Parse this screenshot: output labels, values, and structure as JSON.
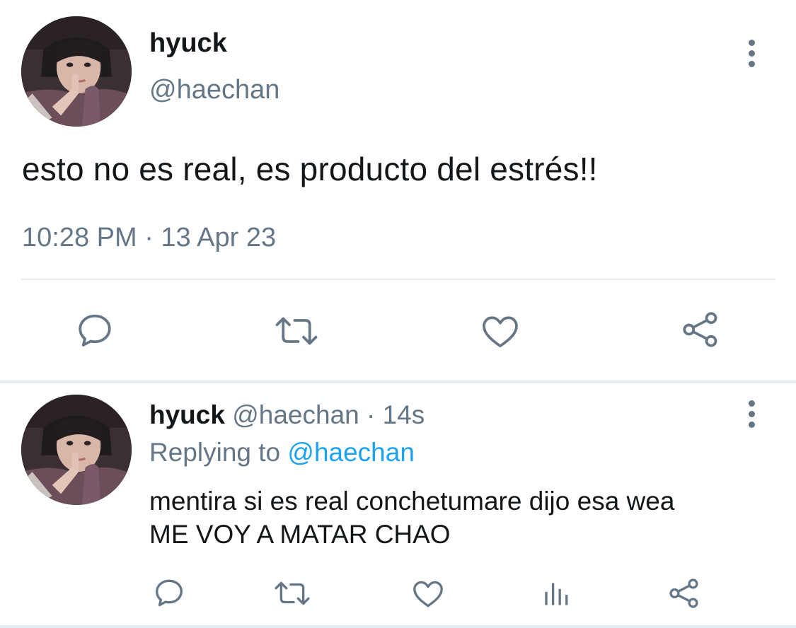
{
  "main_tweet": {
    "display_name": "hyuck",
    "handle": "@haechan",
    "text": "esto no es real, es producto del estrés!!",
    "timestamp": "10:28 PM · 13 Apr 23",
    "actions": [
      "reply-icon",
      "retweet-icon",
      "like-icon",
      "share-icon"
    ]
  },
  "reply_tweet": {
    "display_name": "hyuck",
    "handle": "@haechan",
    "age": "· 14s",
    "replying_prefix": "Replying to ",
    "replying_to": "@haechan",
    "text_line1": "mentira si es real conchetumare dijo esa wea",
    "text_line2": "ME VOY A MATAR CHAO",
    "actions": [
      "reply-icon",
      "retweet-icon",
      "like-icon",
      "analytics-icon",
      "share-icon"
    ]
  },
  "colors": {
    "text_primary": "#14171a",
    "text_secondary": "#657786",
    "accent": "#1da1f2",
    "divider": "#e6ecf0"
  }
}
